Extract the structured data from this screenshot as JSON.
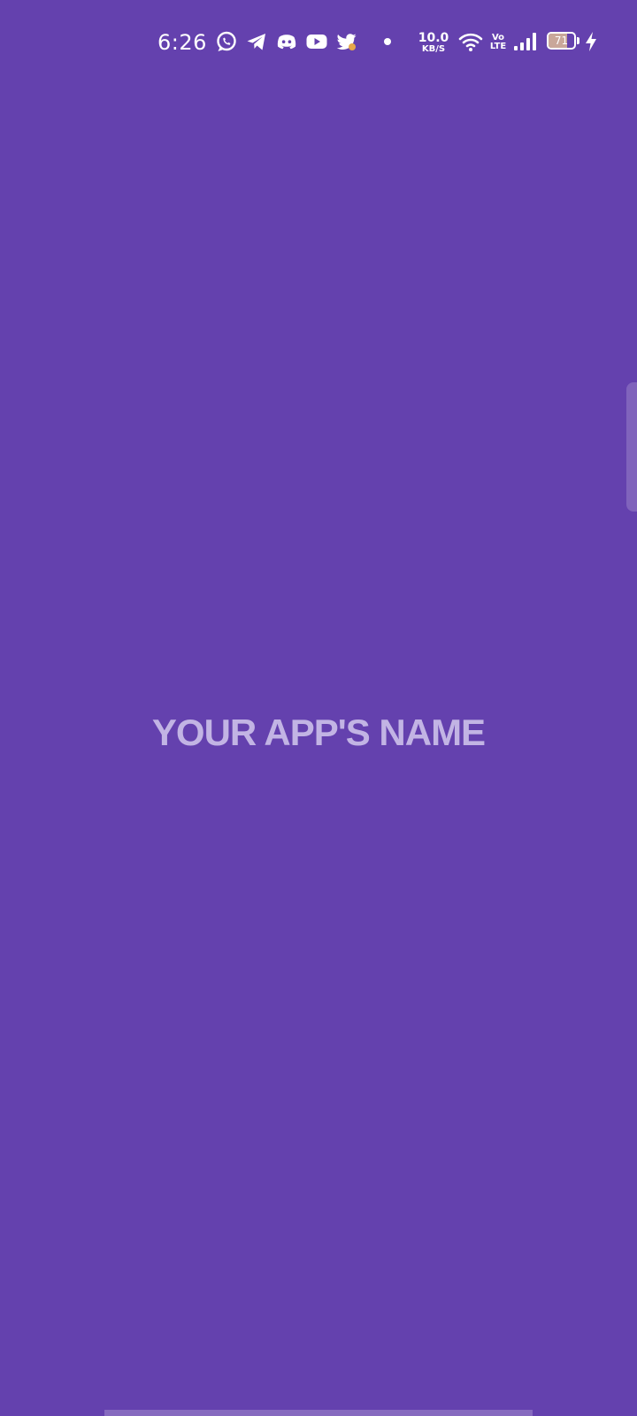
{
  "status_bar": {
    "time": "6:26",
    "notification_icons": [
      "whatsapp-icon",
      "telegram-icon",
      "discord-icon",
      "youtube-icon",
      "twitter-icon"
    ],
    "network_speed_value": "10.0",
    "network_speed_unit": "KB/S",
    "volte_top": "Vo",
    "volte_bottom": "LTE",
    "battery_level": "71",
    "battery_fraction": 0.71,
    "charging": true
  },
  "main": {
    "app_name": "YOUR APP'S NAME"
  },
  "colors": {
    "background": "#6441ae",
    "title_text": "#c2b4e4",
    "status_text": "#ffffff"
  }
}
